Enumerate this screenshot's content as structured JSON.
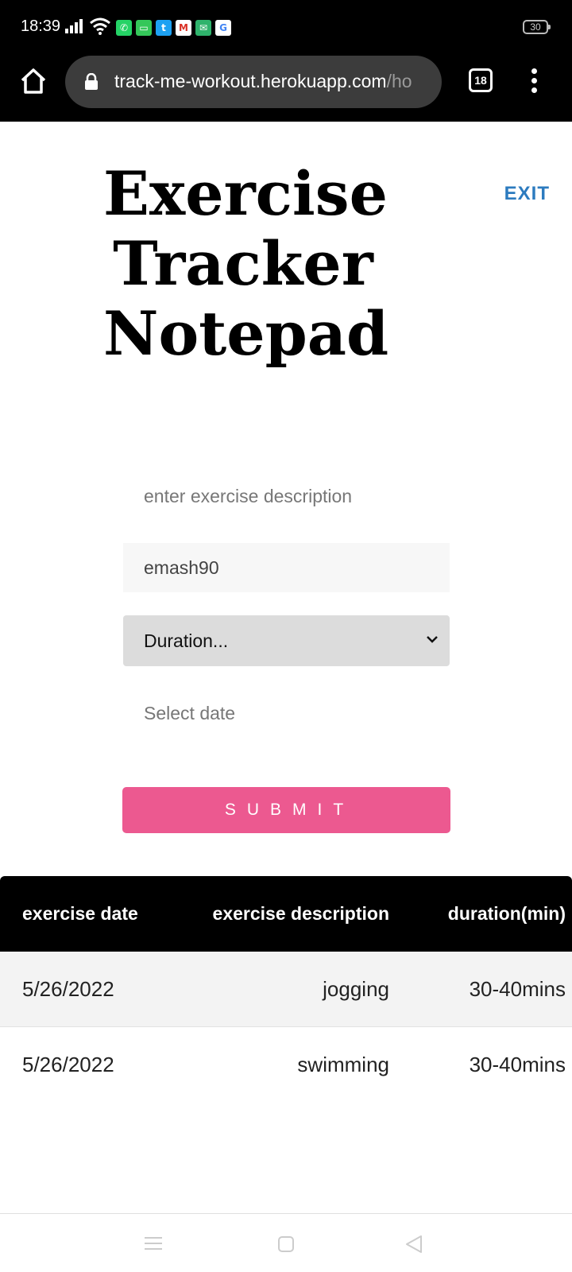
{
  "status_bar": {
    "time": "18:39",
    "battery": "30",
    "icons": [
      "signal-icon",
      "wifi-icon",
      "whatsapp-icon",
      "messages-icon",
      "twitter-icon",
      "gmail-icon",
      "email-icon",
      "google-icon"
    ]
  },
  "browser": {
    "url_host": "track-me-workout.herokuapp.com",
    "url_path": "/ho",
    "tab_count": "18"
  },
  "header": {
    "title": "Exercise Tracker Notepad",
    "exit_label": "EXIT"
  },
  "form": {
    "description_placeholder": "enter exercise description",
    "username_value": "emash90",
    "duration_selected": "Duration...",
    "date_placeholder": "Select date",
    "submit_label": "SUBMIT"
  },
  "table": {
    "headers": [
      "exercise date",
      "exercise description",
      "duration(min)"
    ],
    "rows": [
      [
        "5/26/2022",
        "jogging",
        "30-40mins"
      ],
      [
        "5/26/2022",
        "swimming",
        "30-40mins"
      ]
    ]
  },
  "colors": {
    "accent": "#ec5990",
    "link": "#2c7bbf",
    "header_bg": "#000000"
  }
}
